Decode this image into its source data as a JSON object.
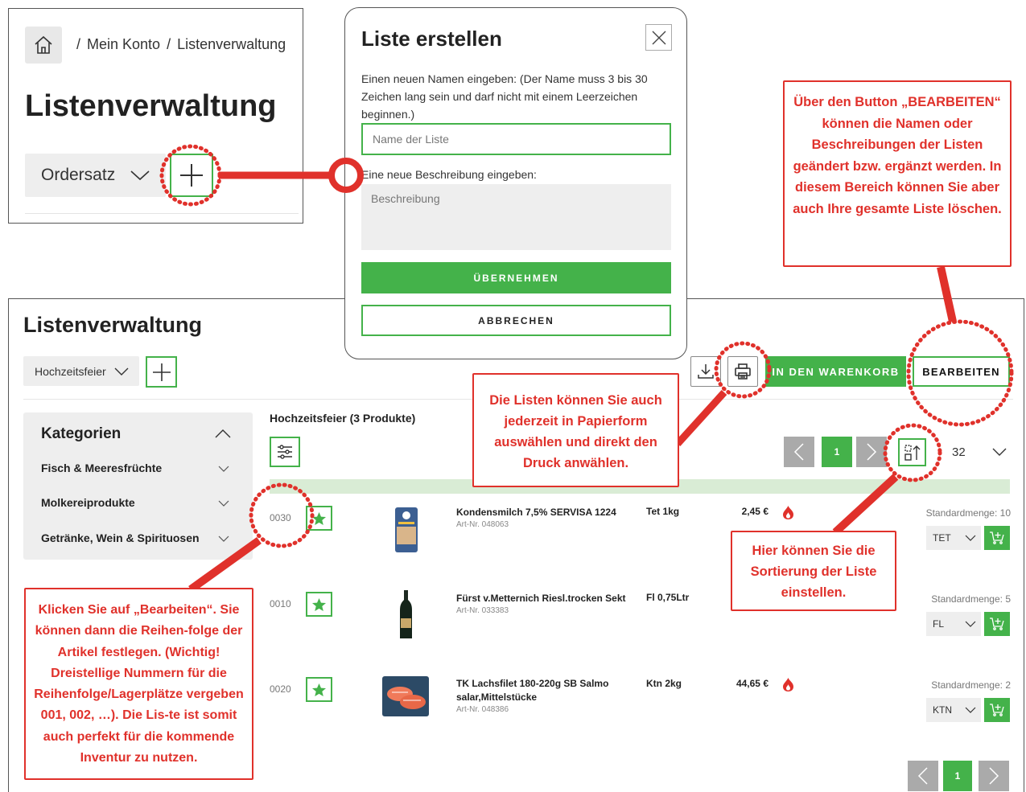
{
  "top_card": {
    "breadcrumb": [
      "Mein Konto",
      "Listenverwaltung"
    ],
    "breadcrumb_sep": "/",
    "title": "Listenverwaltung",
    "list_select": "Ordersatz"
  },
  "dialog": {
    "title": "Liste erstellen",
    "help": "Einen neuen Namen eingeben: (Der Name muss 3 bis 30 Zeichen lang sein und darf nicht mit einem Leerzeichen beginnen.)",
    "name_placeholder": "Name der Liste",
    "desc_label": "Eine neue Beschreibung eingeben:",
    "desc_placeholder": "Beschreibung",
    "submit": "ÜBERNEHMEN",
    "cancel": "ABBRECHEN"
  },
  "panel": {
    "title": "Listenverwaltung",
    "list_select": "Hochzeitsfeier",
    "cart_button": "IN DEN WARENKORB",
    "edit_button": "BEARBEITEN",
    "list_heading": "Hochzeitsfeier (3 Produkte)",
    "current_page": "1",
    "per_page": "32",
    "sidebar": {
      "title": "Kategorien",
      "items": [
        "Fisch & Meeresfrüchte",
        "Molkereiprodukte",
        "Getränke, Wein & Spirituosen"
      ]
    },
    "rows": [
      {
        "pos": "0030",
        "name": "Kondensmilch 7,5% SERVISA 1224",
        "art": "Art-Nr. 048063",
        "unit": "Tet 1kg",
        "price": "2,45 €",
        "std": "Standardmenge: 10",
        "sel": "TET",
        "flame": true
      },
      {
        "pos": "0010",
        "name": "Fürst v.Metternich Riesl.trocken Sekt",
        "art": "Art-Nr. 033383",
        "unit": "Fl 0,75Ltr",
        "price": "",
        "std": "Standardmenge: 5",
        "sel": "FL",
        "flame": false
      },
      {
        "pos": "0020",
        "name": "TK Lachsfilet 180-220g SB Salmo salar,Mittelstücke",
        "art": "Art-Nr. 048386",
        "unit": "Ktn 2kg",
        "price": "44,65 €",
        "std": "Standardmenge: 2",
        "sel": "KTN",
        "flame": true
      }
    ]
  },
  "callouts": {
    "edit": "Über den Button „BEARBEITEN“ können die Namen oder Beschreibungen der Listen geändert bzw. ergänzt werden. In diesem Bereich können Sie aber auch Ihre gesamte Liste löschen.",
    "print": "Die Listen können Sie auch jederzeit in Papierform auswählen und direkt den Druck anwählen.",
    "sort": "Hier können Sie die Sortierung der Liste einstellen.",
    "order": "Klicken Sie auf „Bearbeiten“. Sie können dann die Reihen-folge der Artikel festlegen. (Wichtig! Dreistellige Nummern für die Reihenfolge/Lagerplätze vergeben 001, 002, …). Die Lis-te ist somit auch perfekt für die kommende Inventur zu nutzen."
  },
  "colors": {
    "accent": "#44b24a",
    "callout": "#e0312b",
    "band": "#d9ecd5"
  }
}
